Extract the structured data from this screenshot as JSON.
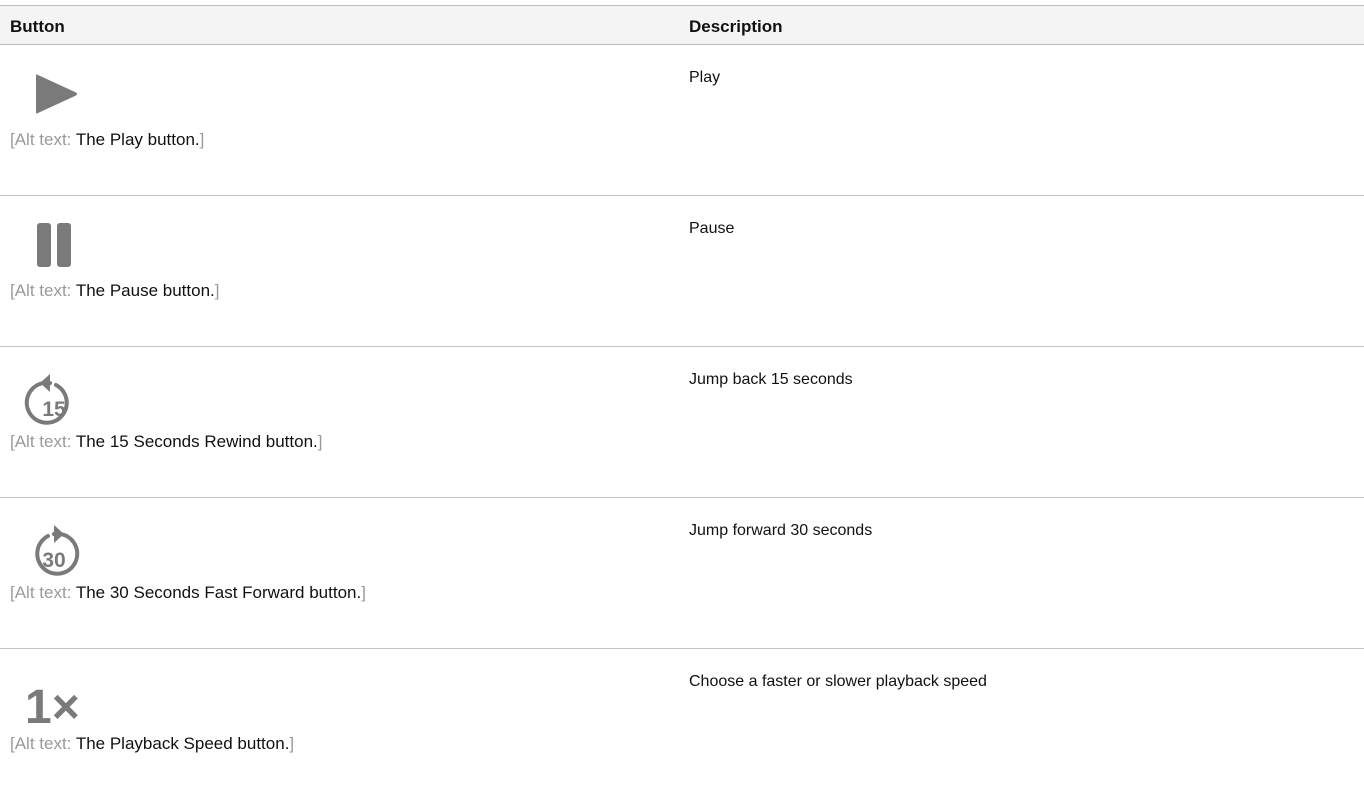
{
  "header": {
    "button_col": "Button",
    "description_col": "Description"
  },
  "alt_prefix": "[Alt text: ",
  "alt_suffix": "]",
  "icon_color": "#7a7a7a",
  "rows": [
    {
      "icon": "play-icon",
      "alt_text": "The Play button.",
      "description": "Play"
    },
    {
      "icon": "pause-icon",
      "alt_text": "The Pause button.",
      "description": "Pause"
    },
    {
      "icon": "rewind-15-icon",
      "icon_label": "15",
      "alt_text": "The 15 Seconds Rewind button.",
      "description": "Jump back 15 seconds"
    },
    {
      "icon": "forward-30-icon",
      "icon_label": "30",
      "alt_text": "The 30 Seconds Fast Forward button.",
      "description": "Jump forward 30 seconds"
    },
    {
      "icon": "playback-speed-icon",
      "icon_label": "1×",
      "alt_text": "The Playback Speed button.",
      "description": "Choose a faster or slower playback speed"
    }
  ]
}
